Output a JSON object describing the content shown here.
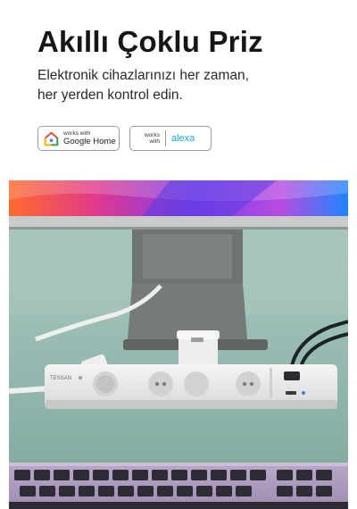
{
  "header": {
    "title": "Akıllı Çoklu Priz",
    "subtitle_line1": "Elektronik cihazlarınızı her zaman,",
    "subtitle_line2": "her yerden kontrol edin."
  },
  "badges": {
    "google": {
      "small": "works with",
      "big": "Google Home",
      "icon": "google-home-icon"
    },
    "alexa": {
      "small_1": "works",
      "small_2": "with",
      "big": "alexa",
      "color": "#1aa8d8"
    }
  },
  "photo": {
    "brand_label": "TESSAN",
    "accent_colors": [
      "#ff6a2b",
      "#e23a8a",
      "#7a3cf0",
      "#1e86ff"
    ]
  }
}
